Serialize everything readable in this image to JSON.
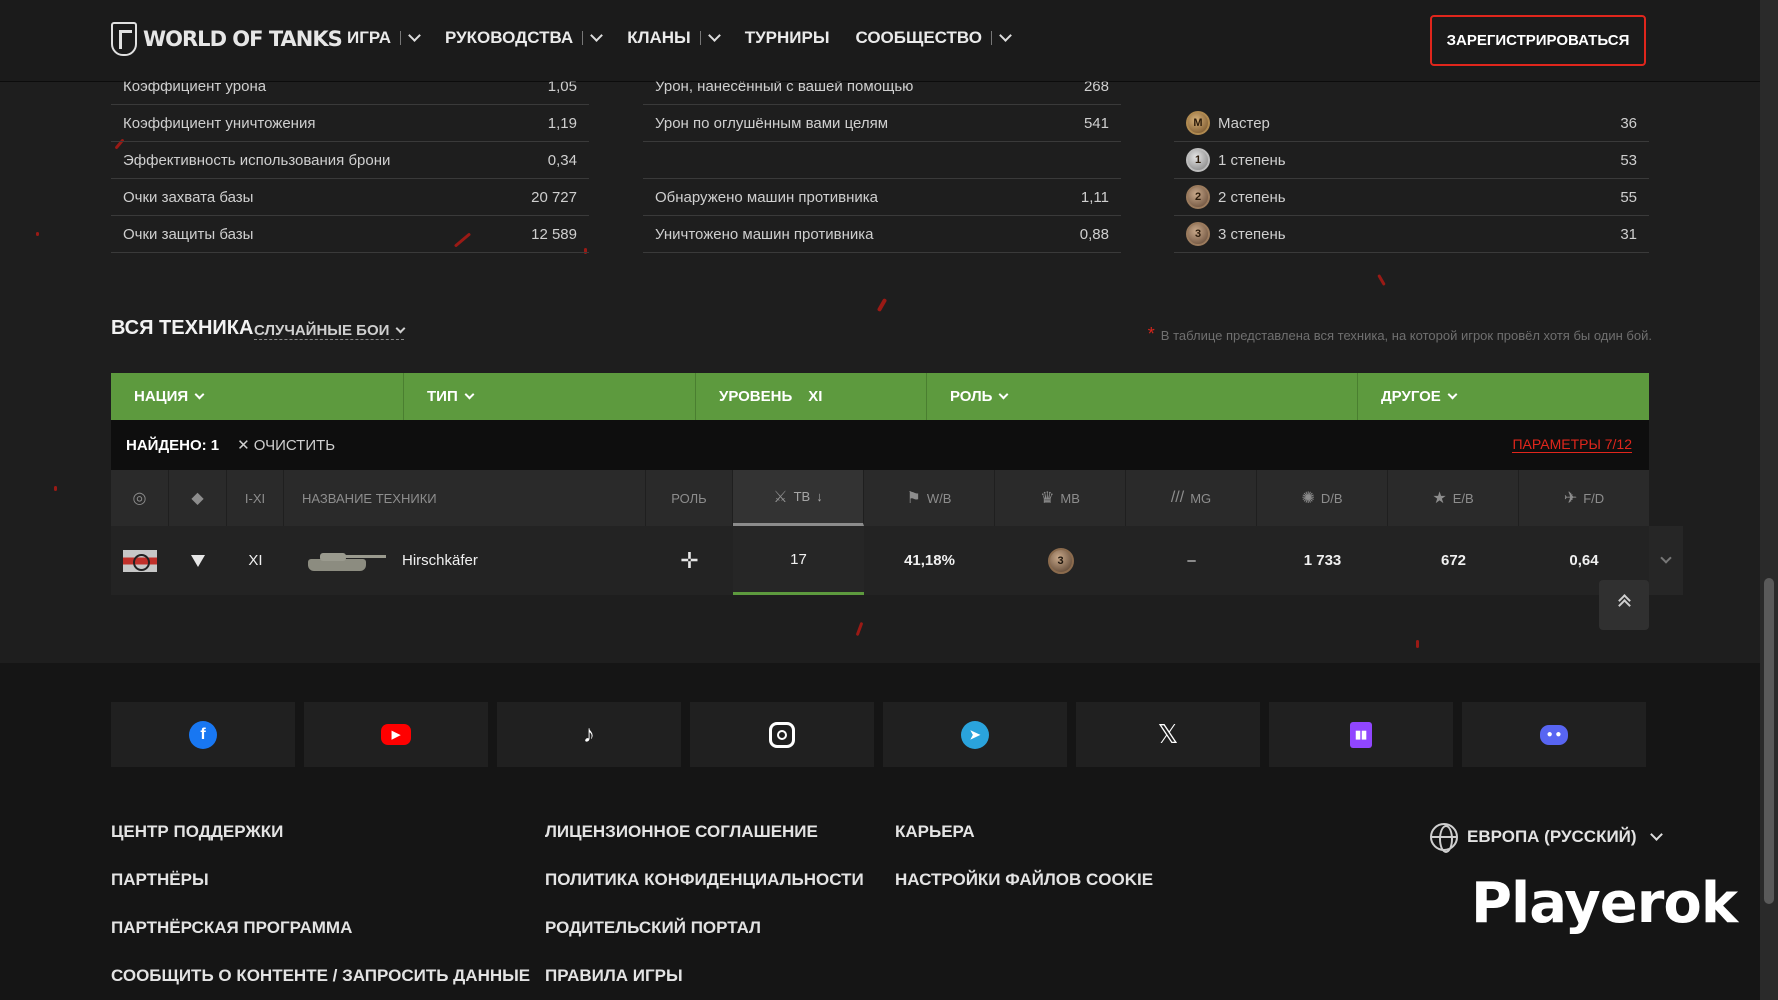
{
  "header": {
    "logo": "WORLD OF TANKS",
    "nav": [
      {
        "label": "ИГРА",
        "dropdown": true
      },
      {
        "label": "РУКОВОДСТВА",
        "dropdown": true
      },
      {
        "label": "КЛАНЫ",
        "dropdown": true
      },
      {
        "label": "ТУРНИРЫ",
        "dropdown": false
      },
      {
        "label": "СООБЩЕСТВО",
        "dropdown": true
      }
    ],
    "register": "ЗАРЕГИСТРИРОВАТЬСЯ"
  },
  "stats": {
    "col1": [
      {
        "label": "Коэффициент урона",
        "value": "1,05"
      },
      {
        "label": "Коэффициент уничтожения",
        "value": "1,19"
      },
      {
        "label": "Эффективность использования брони",
        "value": "0,34"
      },
      {
        "label": "Очки захвата базы",
        "value": "20 727"
      },
      {
        "label": "Очки защиты базы",
        "value": "12 589"
      }
    ],
    "col2": [
      {
        "label": "Урон, нанесённый с вашей помощью",
        "value": "268"
      },
      {
        "label": "Урон по оглушённым вами целям",
        "value": "541"
      },
      {
        "label": "",
        "value": ""
      },
      {
        "label": "Обнаружено машин противника",
        "value": "1,11"
      },
      {
        "label": "Уничтожено машин противника",
        "value": "0,88"
      }
    ],
    "col3": [
      {
        "label": "Мастер",
        "value": "36",
        "badge": "M"
      },
      {
        "label": "1 степень",
        "value": "53",
        "badge": "1"
      },
      {
        "label": "2 степень",
        "value": "55",
        "badge": "2"
      },
      {
        "label": "3 степень",
        "value": "31",
        "badge": "3"
      }
    ]
  },
  "vehicles": {
    "title": "ВСЯ ТЕХНИКА",
    "battle_type": "СЛУЧАЙНЫЕ БОИ",
    "note": "В таблице представлена вся техника, на которой игрок провёл хотя бы один бой.",
    "filters": [
      {
        "label": "НАЦИЯ",
        "value": ""
      },
      {
        "label": "ТИП",
        "value": ""
      },
      {
        "label": "УРОВЕНЬ",
        "value": "XI"
      },
      {
        "label": "РОЛЬ",
        "value": ""
      },
      {
        "label": "ДРУГОЕ",
        "value": ""
      }
    ],
    "found": "НАЙДЕНО: 1",
    "clear": "ОЧИСТИТЬ",
    "params": "ПАРАМЕТРЫ 7/12",
    "headers": {
      "tier": "I-XI",
      "name": "НАЗВАНИЕ ТЕХНИКИ",
      "role": "РОЛЬ",
      "tb": "ТВ",
      "wb": "W/B",
      "mb": "MB",
      "mg": "MG",
      "db": "D/B",
      "eb": "E/B",
      "fd": "F/D"
    },
    "row": {
      "tier": "XI",
      "name": "Hirschkäfer",
      "tb": "17",
      "wb": "41,18%",
      "mb_badge": "3",
      "mg": "–",
      "db": "1 733",
      "eb": "672",
      "fd": "0,64"
    }
  },
  "footer": {
    "socials": [
      "facebook-icon",
      "youtube-icon",
      "tiktok-icon",
      "instagram-icon",
      "telegram-icon",
      "x-icon",
      "twitch-icon",
      "discord-icon"
    ],
    "links_col1": [
      "ЦЕНТР ПОДДЕРЖКИ",
      "ПАРТНЁРЫ",
      "ПАРТНЁРСКАЯ ПРОГРАММА",
      "СООБЩИТЬ О КОНТЕНТЕ / ЗАПРОСИТЬ ДАННЫЕ"
    ],
    "links_col2": [
      "ЛИЦЕНЗИОННОЕ СОГЛАШЕНИЕ",
      "ПОЛИТИКА КОНФИДЕНЦИАЛЬНОСТИ",
      "РОДИТЕЛЬСКИЙ ПОРТАЛ",
      "ПРАВИЛА ИГРЫ"
    ],
    "links_col3": [
      "КАРЬЕРА",
      "НАСТРОЙКИ ФАЙЛОВ COOKIE"
    ],
    "region": "ЕВРОПА (РУССКИЙ)"
  },
  "watermark": "Playerok",
  "colors": {
    "accent": "#e0261c",
    "filter_bar": "#5d9a3e"
  }
}
